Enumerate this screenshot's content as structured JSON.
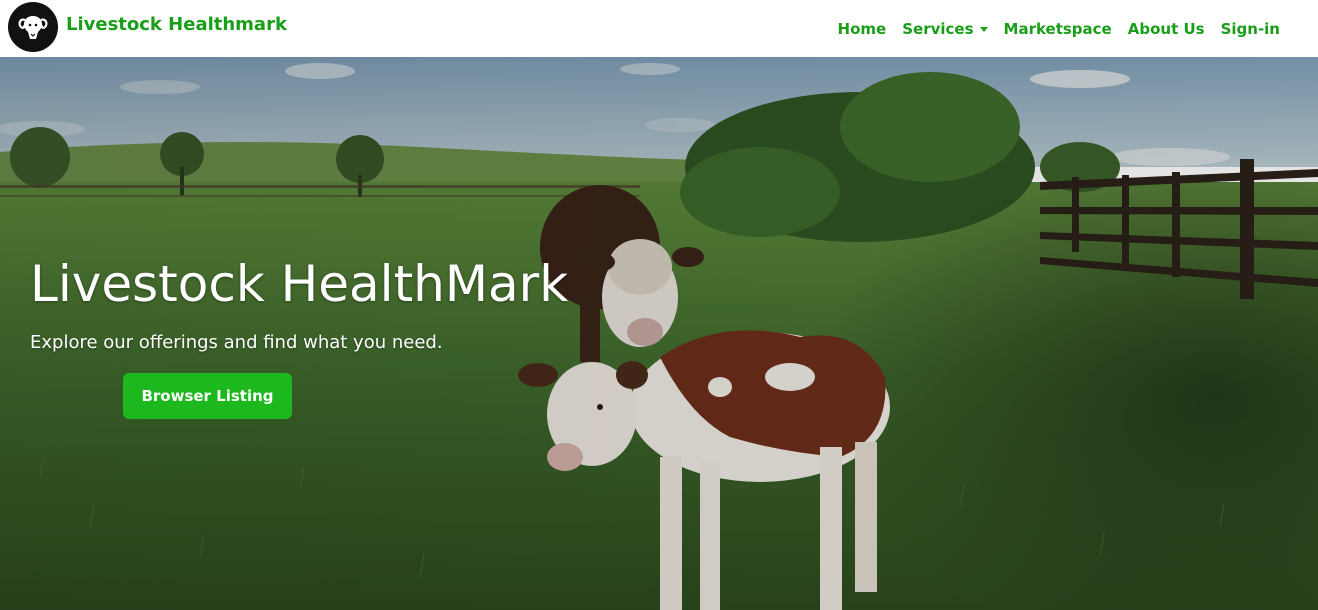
{
  "navbar": {
    "brand": "Livestock Healthmark",
    "links": [
      {
        "label": "Home"
      },
      {
        "label": "Services",
        "has_dropdown": true
      },
      {
        "label": "Marketspace"
      },
      {
        "label": "About Us"
      },
      {
        "label": "Sign-in"
      }
    ]
  },
  "hero": {
    "title": "Livestock HealthMark",
    "subtitle": "Explore our offerings and find what you need.",
    "cta_label": "Browser Listing"
  },
  "colors": {
    "brand_green": "#1a9e1a",
    "button_green": "#1db81d",
    "navbar_bg": "#ffffff",
    "logo_bg": "#111111"
  },
  "icons": {
    "logo": "ram-head-icon"
  }
}
